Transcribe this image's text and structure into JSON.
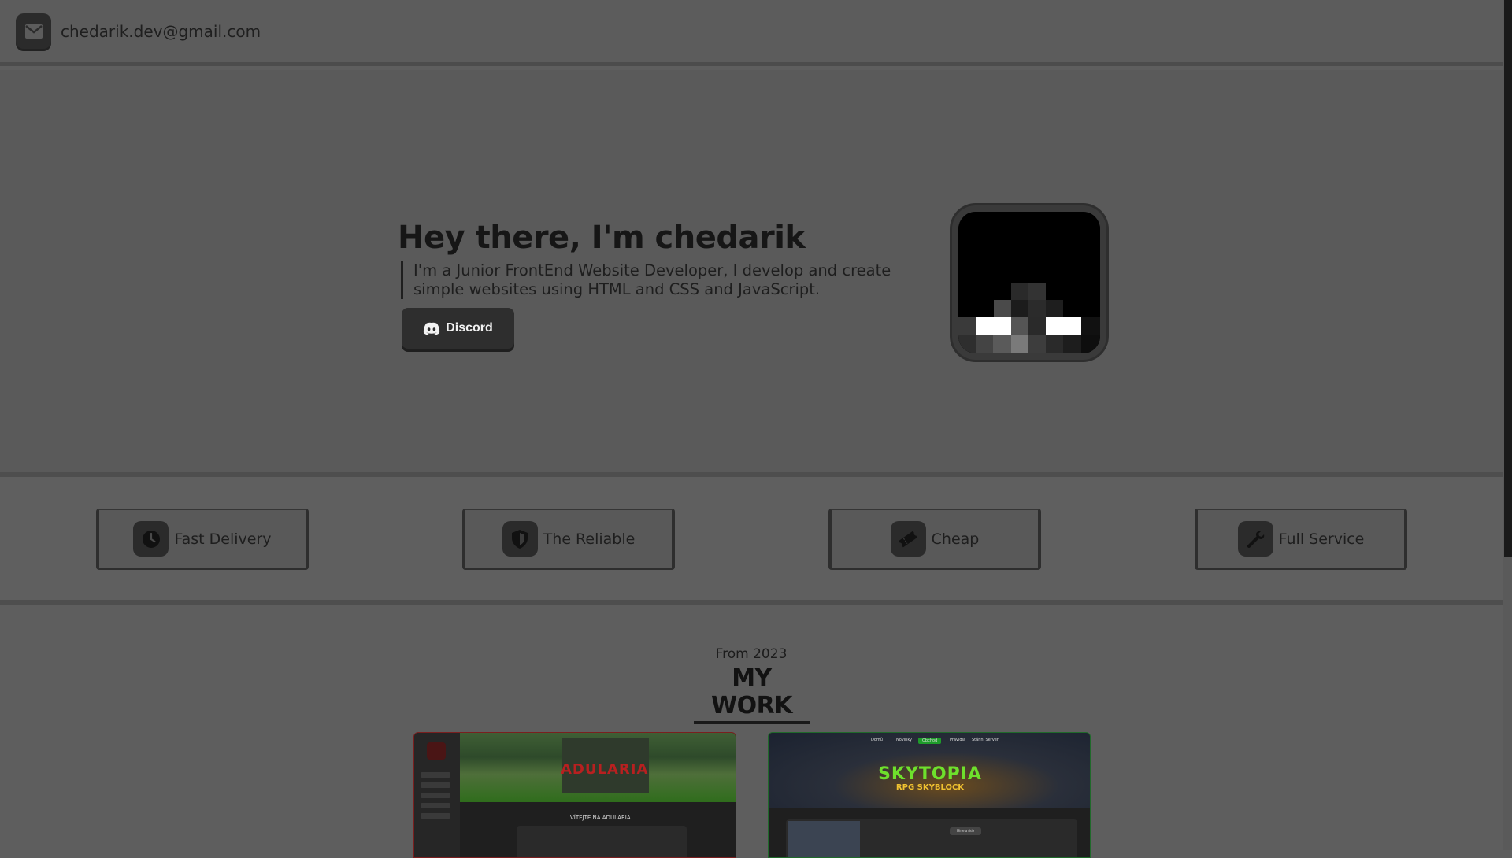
{
  "header": {
    "email": "chedarik.dev@gmail.com",
    "mail_icon": "envelope-icon"
  },
  "hero": {
    "title": "Hey there, I'm chedarik",
    "description": "I'm a Junior FrontEnd Website Developer, I develop and create simple websites using HTML and CSS and JavaScript.",
    "discord_label": "Discord",
    "discord_icon": "discord-icon",
    "avatar_icon": "pixel-avatar"
  },
  "features": [
    {
      "label": "Fast Delivery",
      "icon": "clock-icon"
    },
    {
      "label": "The Reliable",
      "icon": "shield-icon"
    },
    {
      "label": "Cheap",
      "icon": "ticket-icon"
    },
    {
      "label": "Full Service",
      "icon": "wrench-icon"
    }
  ],
  "work": {
    "subtitle": "From 2023",
    "title": "MY WORK",
    "projects": [
      {
        "name": "ADULARIA",
        "heading": "VÍTEJTE NA ADULARIA",
        "accent": "#b82020"
      },
      {
        "name": "SKYTOPIA",
        "tagline": "RPG SKYBLOCK",
        "accent": "#6ee02c",
        "nav": [
          "Domů",
          "Novinky",
          "Obchod",
          "Pravidla",
          "Stáhni Server"
        ],
        "button": "Mine a ride"
      }
    ]
  },
  "colors": {
    "background": "#5e5e5e",
    "dark": "#2b2b2b",
    "text": "#1e1e1e"
  }
}
